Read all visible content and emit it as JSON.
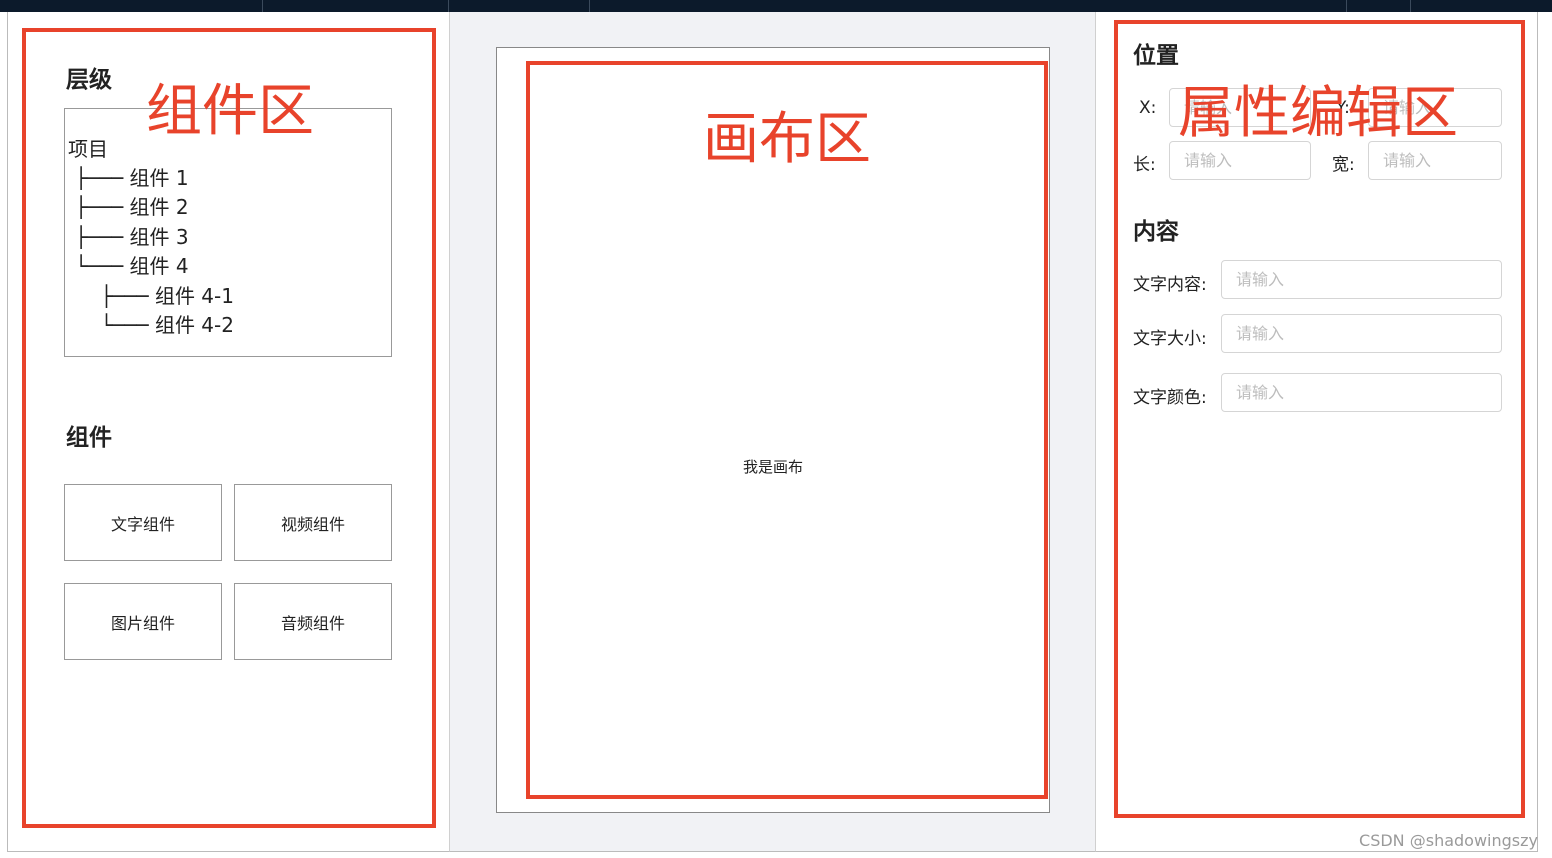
{
  "left": {
    "layers_title": "层级",
    "tree": {
      "root": "项目",
      "lines": [
        "├─── 组件 1",
        "├─── 组件 2",
        "├─── 组件 3",
        "└─── 组件 4",
        "    ├─── 组件 4-1",
        "    └─── 组件 4-2"
      ]
    },
    "components_title": "组件",
    "components": [
      "文字组件",
      "视频组件",
      "图片组件",
      "音频组件"
    ]
  },
  "center": {
    "canvas_text": "我是画布"
  },
  "right": {
    "position_title": "位置",
    "x_label": "X:",
    "y_label": "Y:",
    "length_label": "长:",
    "width_label": "宽:",
    "content_title": "内容",
    "text_content_label": "文字内容:",
    "text_size_label": "文字大小:",
    "text_color_label": "文字颜色:",
    "placeholder": "请输入"
  },
  "annotations": {
    "component_area": "组件区",
    "canvas_area": "画布区",
    "property_area": "属性编辑区",
    "color": "#e8432b"
  },
  "watermark": "CSDN @shadowingszy"
}
